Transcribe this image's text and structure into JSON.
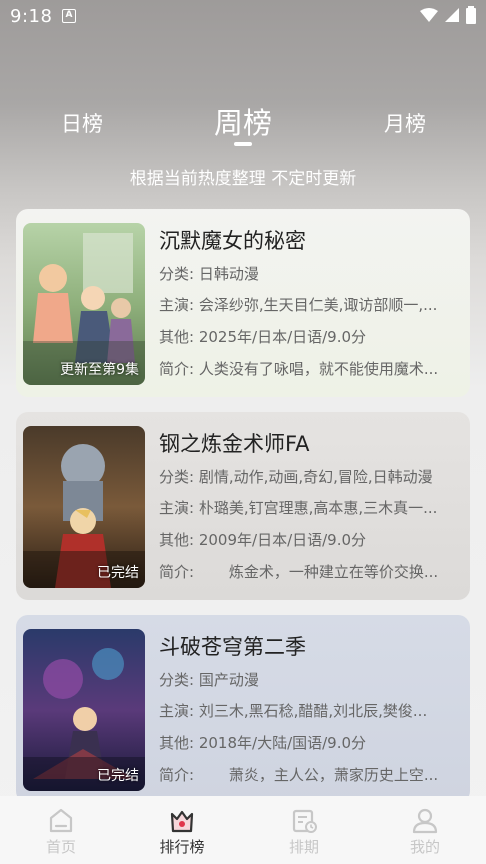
{
  "status_bar": {
    "time": "9:18",
    "notif_letter": "A"
  },
  "rank_tabs": {
    "daily": "日榜",
    "weekly": "周榜",
    "monthly": "月榜",
    "active": "weekly"
  },
  "subtitle": "根据当前热度整理 不定时更新",
  "labels": {
    "category": "分类:",
    "cast": "主演:",
    "other": "其他:",
    "intro": "简介:"
  },
  "items": [
    {
      "title": "沉默魔女的秘密",
      "badge": "更新至第9集",
      "poster_caption": "サイレント・ウィッチ",
      "category": "日韩动漫",
      "cast": "会泽纱弥,生天目仁美,诹访部顺一,...",
      "other": "2025年/日本/日语/9.0分",
      "intro": "人类没有了咏唱，就不能使用魔术..."
    },
    {
      "title": "钢之炼金术师FA",
      "badge": "已完结",
      "poster_caption": "鋼の錬金術師",
      "category": "剧情,动作,动画,奇幻,冒险,日韩动漫",
      "cast": "朴璐美,钉宫理惠,高本惠,三木真一...",
      "other": "2009年/日本/日语/9.0分",
      "intro": "　　炼金术，一种建立在等价交换..."
    },
    {
      "title": "斗破苍穹第二季",
      "badge": "已完结",
      "poster_caption": "斗破苍穹",
      "category": "国产动漫",
      "cast": "刘三木,黑石稔,醋醋,刘北辰,樊俊...",
      "other": "2018年/大陆/国语/9.0分",
      "intro": "　　萧炎，主人公，萧家历史上空..."
    }
  ],
  "bottom_nav": [
    {
      "label": "首页",
      "icon": "home-icon",
      "active": false
    },
    {
      "label": "排行榜",
      "icon": "crown-rank-icon",
      "active": true
    },
    {
      "label": "排期",
      "icon": "calendar-clock-icon",
      "active": false
    },
    {
      "label": "我的",
      "icon": "user-icon",
      "active": false
    }
  ],
  "colors": {
    "active_nav": "#333333",
    "inactive_nav": "#c7c7c7",
    "rank_accent": "#e0344a"
  }
}
